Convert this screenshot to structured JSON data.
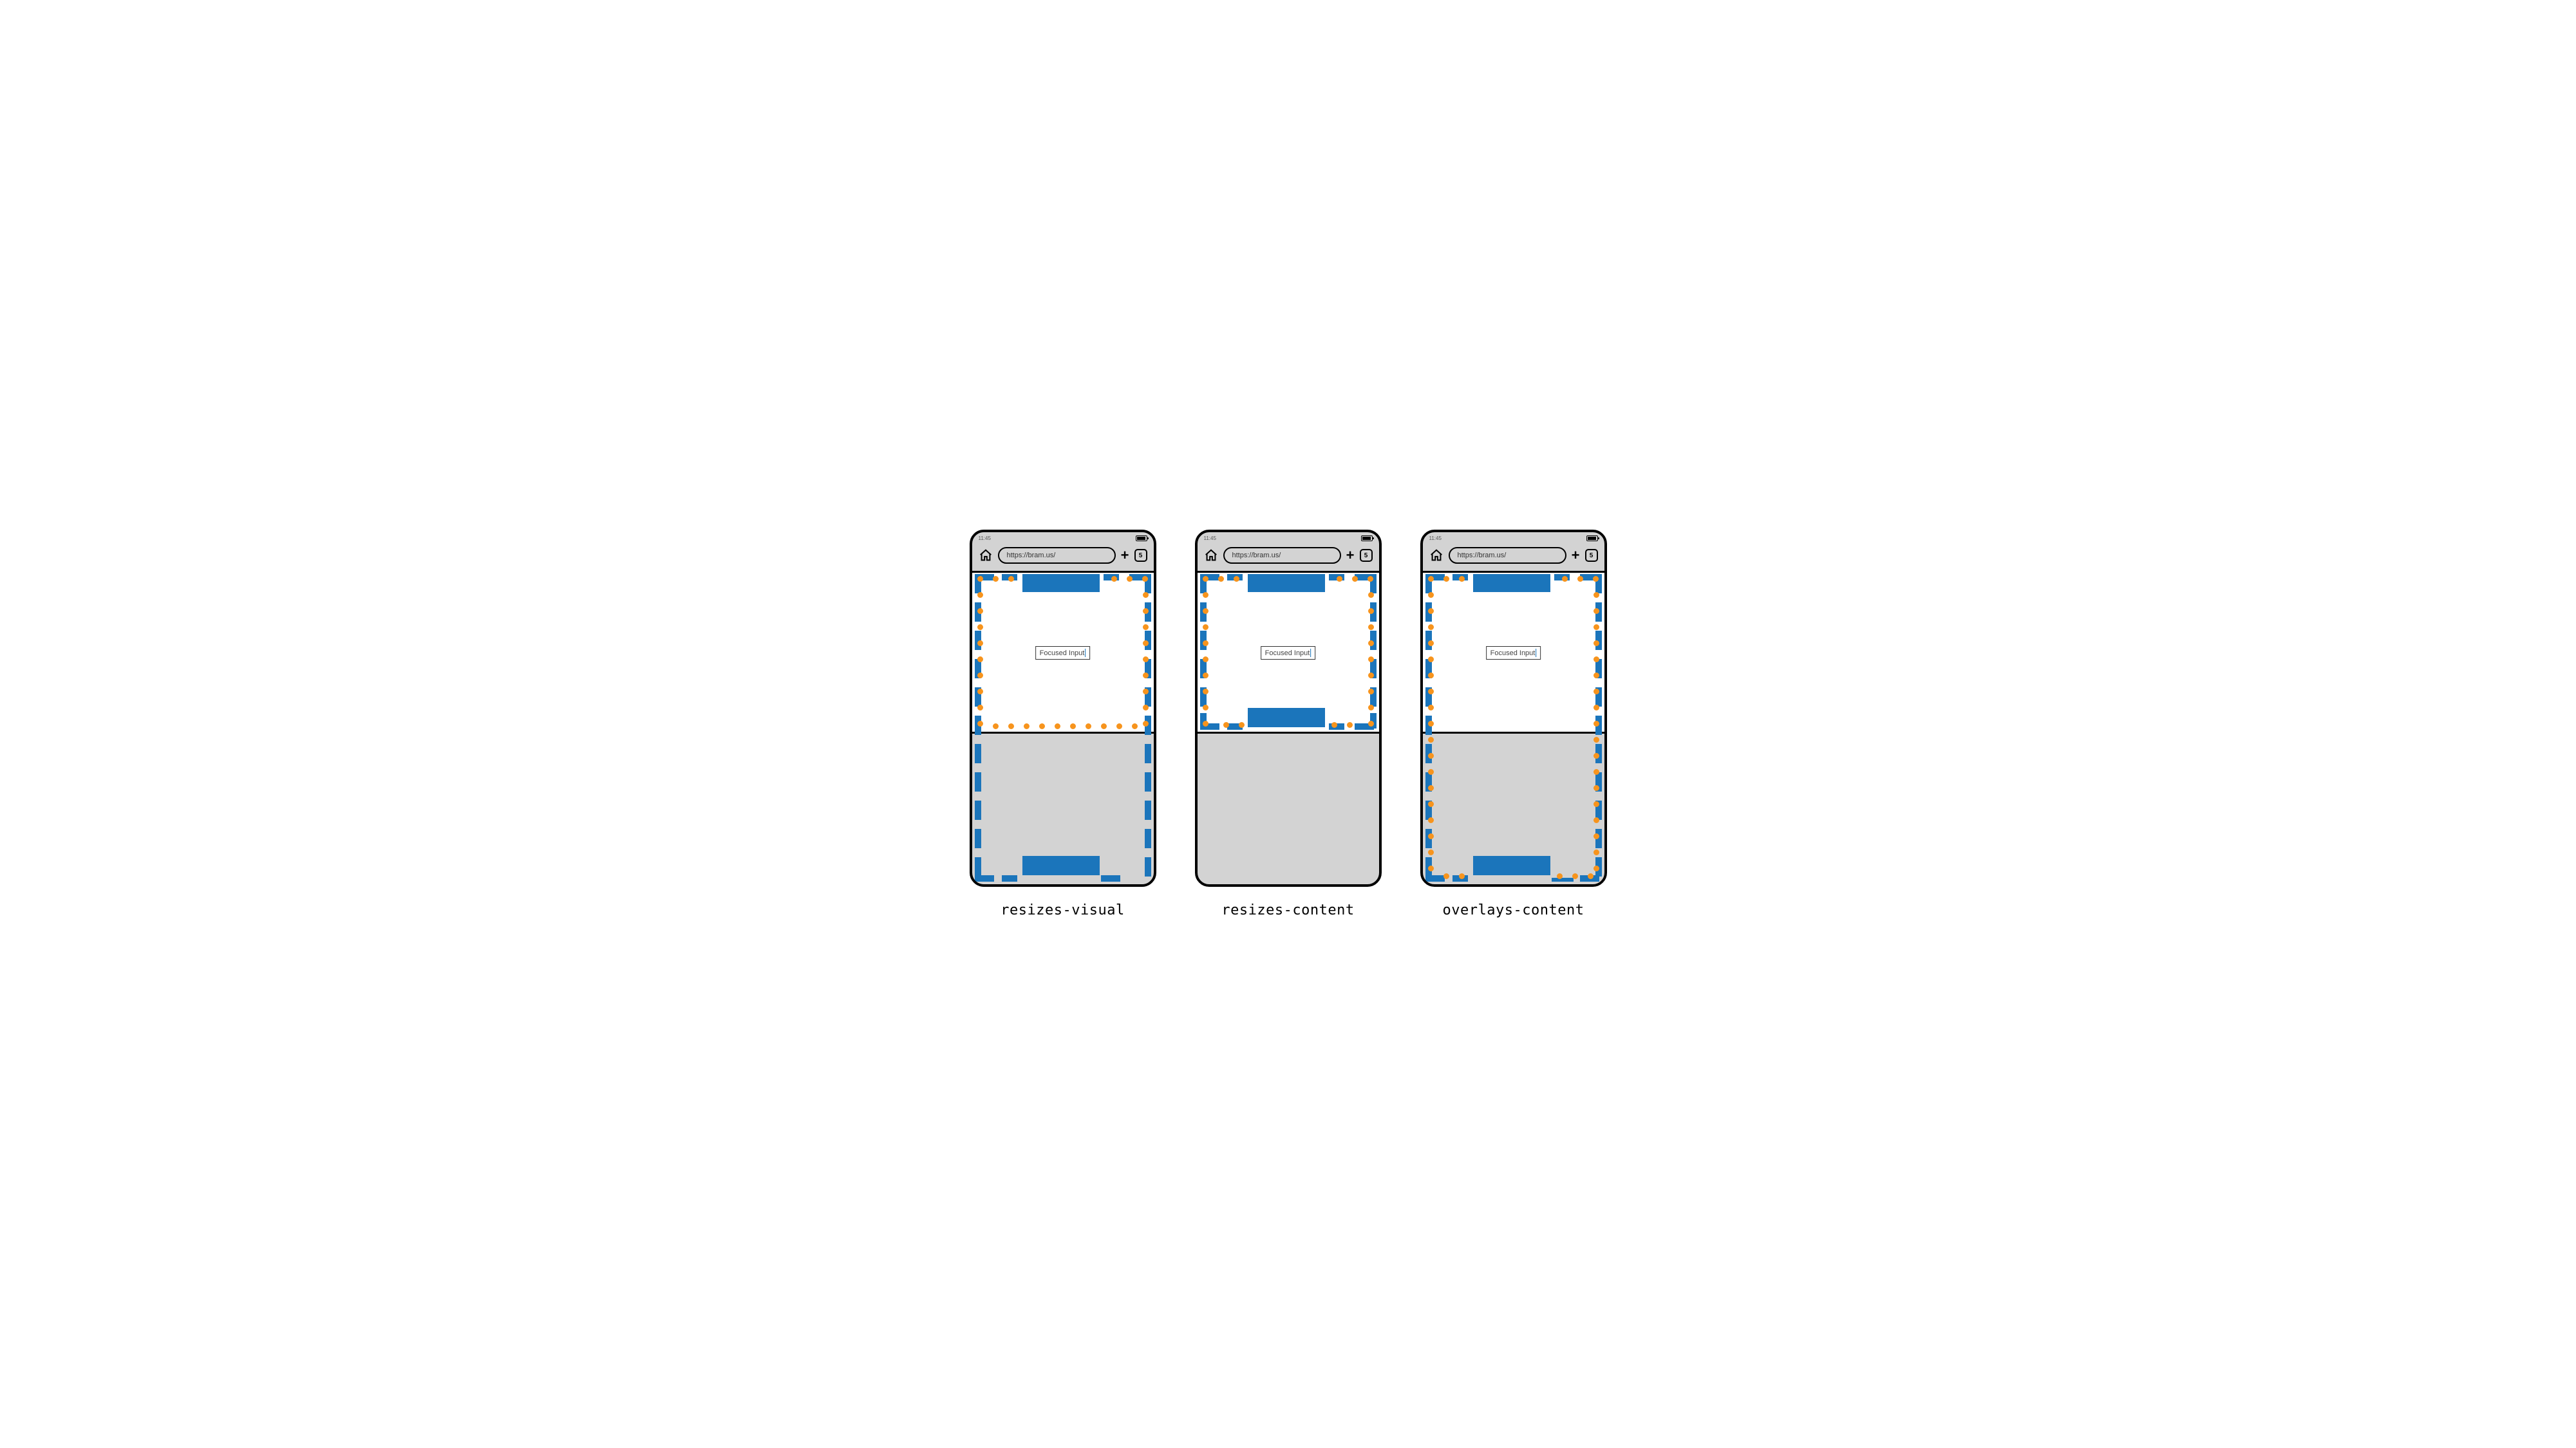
{
  "status_time": "11:45",
  "url": "https://bram.us/",
  "tab_count": "5",
  "input_label": "Focused Input",
  "captions": {
    "a": "resizes-visual",
    "b": "resizes-content",
    "c": "overlays-content"
  }
}
